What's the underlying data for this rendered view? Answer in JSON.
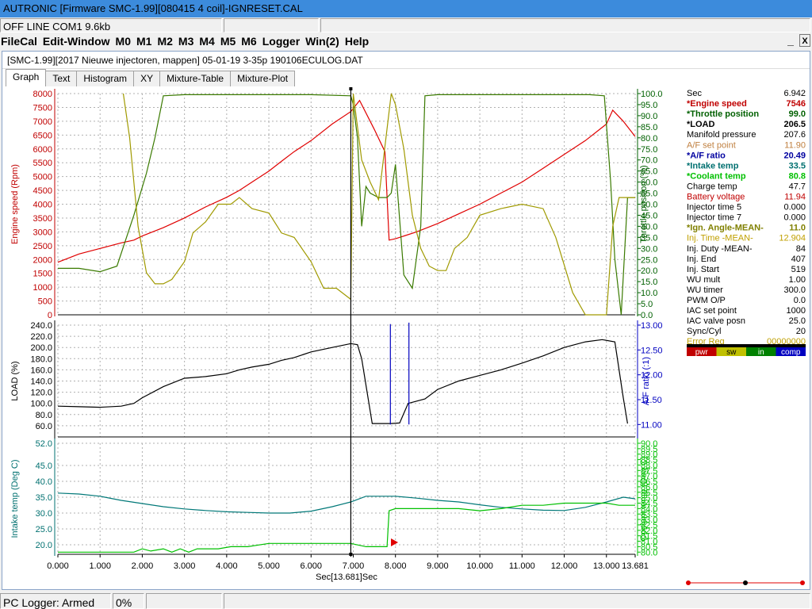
{
  "window": {
    "title": "AUTRONIC [Firmware SMC-1.99][080415 4 coil]-IGNRESET.CAL",
    "status_left": "OFF LINE COM1 9.6kb"
  },
  "menu": [
    "FileCal",
    "Edit-Window",
    "M0",
    "M1",
    "M2",
    "M3",
    "M4",
    "M5",
    "M6",
    "Logger",
    "Win(2)",
    "Help"
  ],
  "win_buttons": {
    "minimize": "_",
    "close": "X"
  },
  "doc": {
    "title": "[SMC-1.99][2017 Nieuwe injectoren, mappen] 05-01-19 3-35p 190106ECULOG.DAT",
    "tabs": [
      "Graph",
      "Text",
      "Histogram",
      "XY",
      "Mixture-Table",
      "Mixture-Plot"
    ],
    "active_tab": 0
  },
  "statusbar": {
    "logger": "PC Logger: Armed",
    "percent": "0%"
  },
  "data_panel": {
    "rows": [
      {
        "label": "Sec",
        "value": "6.942",
        "color": "#000000",
        "bold": false
      },
      {
        "label": "*Engine speed",
        "value": "7546",
        "color": "#c00000",
        "bold": true
      },
      {
        "label": "*Throttle position",
        "value": "99.0",
        "color": "#006000",
        "bold": true
      },
      {
        "label": "*LOAD",
        "value": "206.5",
        "color": "#000000",
        "bold": true
      },
      {
        "label": "Manifold pressure",
        "value": "207.6",
        "color": "#000000",
        "bold": false
      },
      {
        "label": "A/F set point",
        "value": "11.90",
        "color": "#c08040",
        "bold": false
      },
      {
        "label": "*A/F ratio",
        "value": "20.49",
        "color": "#0000a0",
        "bold": true
      },
      {
        "label": "*Intake temp",
        "value": "33.5",
        "color": "#007070",
        "bold": true
      },
      {
        "label": "*Coolant temp",
        "value": "80.8",
        "color": "#00c000",
        "bold": true
      },
      {
        "label": "Charge temp",
        "value": "47.7",
        "color": "#000000",
        "bold": false
      },
      {
        "label": "Battery voltage",
        "value": "11.94",
        "color": "#c00000",
        "bold": false
      },
      {
        "label": "Injector time 5",
        "value": "0.000",
        "color": "#000000",
        "bold": false
      },
      {
        "label": "Injector time 7",
        "value": "0.000",
        "color": "#000000",
        "bold": false
      },
      {
        "label": "*Ign. Angle-MEAN-",
        "value": "11.0",
        "color": "#808000",
        "bold": true
      },
      {
        "label": "Inj. Time -MEAN-",
        "value": "12.904",
        "color": "#c0a000",
        "bold": false
      },
      {
        "label": "Inj. Duty -MEAN-",
        "value": "84",
        "color": "#000000",
        "bold": false
      },
      {
        "label": "Inj. End",
        "value": "407",
        "color": "#000000",
        "bold": false
      },
      {
        "label": "Inj. Start",
        "value": "519",
        "color": "#000000",
        "bold": false
      },
      {
        "label": "WU mult",
        "value": "1.00",
        "color": "#000000",
        "bold": false
      },
      {
        "label": "WU timer",
        "value": "300.0",
        "color": "#000000",
        "bold": false
      },
      {
        "label": "PWM O/P",
        "value": "0.0",
        "color": "#000000",
        "bold": false
      },
      {
        "label": "IAC set point",
        "value": "1000",
        "color": "#000000",
        "bold": false
      },
      {
        "label": "IAC valve posn",
        "value": "25.0",
        "color": "#000000",
        "bold": false
      },
      {
        "label": "Sync/Cyl",
        "value": "20",
        "color": "#000000",
        "bold": false
      },
      {
        "label": "Error Reg",
        "value": "00000000",
        "color": "#c0a000",
        "bold": false
      }
    ],
    "flags": [
      {
        "label": "pwr",
        "bg": "#c00000",
        "fg": "#ffffff"
      },
      {
        "label": "sw",
        "bg": "#c0c000",
        "fg": "#000000"
      },
      {
        "label": "in",
        "bg": "#008000",
        "fg": "#ffffff"
      },
      {
        "label": "comp",
        "bg": "#0000c0",
        "fg": "#ffffff"
      }
    ]
  },
  "chart_data": {
    "type": "line",
    "x_label": "Sec[13.681]Sec",
    "x_range": [
      0,
      13.681
    ],
    "x_ticks": [
      "0.000",
      "1.000",
      "2.000",
      "3.000",
      "4.000",
      "5.000",
      "6.000",
      "7.000",
      "8.000",
      "9.000",
      "10.000",
      "11.000",
      "12.000",
      "13.000",
      "13.681"
    ],
    "cursor_x": 6.942,
    "grid": true,
    "panels": [
      {
        "left_label": "Engine speed (Rpm)",
        "right_label": "Throttle position (%)",
        "left_range": [
          0,
          8000
        ],
        "left_ticks": [
          "0",
          "500",
          "1000",
          "1500",
          "2000",
          "2500",
          "3000",
          "3500",
          "4000",
          "4500",
          "5000",
          "5500",
          "6000",
          "6500",
          "7000",
          "7500",
          "8000"
        ],
        "right_range": [
          0,
          100
        ],
        "right_ticks": [
          "0.0",
          "5.0",
          "10.0",
          "15.0",
          "20.0",
          "25.0",
          "30.0",
          "35.0",
          "40.0",
          "45.0",
          "50.0",
          "55.0",
          "60.0",
          "65.0",
          "70.0",
          "75.0",
          "80.0",
          "85.0",
          "90.0",
          "95.0",
          "100.0"
        ],
        "left_color": "#c00000",
        "right_color": "#006000",
        "series": [
          {
            "axis": "left",
            "color": "#e00000",
            "x": [
              0,
              0.5,
              1,
              1.5,
              1.8,
              2,
              2.5,
              3,
              3.5,
              4,
              4.3,
              4.6,
              5,
              5.3,
              5.6,
              6,
              6.5,
              6.942,
              7.15,
              7.5,
              7.75,
              7.85,
              8,
              8.5,
              9,
              9.5,
              10,
              10.5,
              11,
              11.5,
              12,
              12.5,
              13,
              13.15,
              13.4,
              13.681
            ],
            "y": [
              1900,
              2200,
              2400,
              2600,
              2700,
              2850,
              3150,
              3500,
              3900,
              4250,
              4500,
              4800,
              5200,
              5550,
              5900,
              6300,
              6900,
              7350,
              7750,
              6700,
              5900,
              2700,
              2750,
              3000,
              3300,
              3650,
              4000,
              4400,
              4800,
              5300,
              5800,
              6300,
              6900,
              7400,
              7000,
              6450
            ]
          },
          {
            "axis": "right",
            "color": "#3a7a00",
            "x": [
              0,
              0.5,
              1,
              1.4,
              1.8,
              2.1,
              2.3,
              2.5,
              3,
              5,
              6,
              6.942,
              7.0,
              7.1,
              7.2,
              7.3,
              7.4,
              7.6,
              7.8,
              7.9,
              8.0,
              8.2,
              8.4,
              8.6,
              8.7,
              9,
              10,
              11,
              12,
              12.6,
              12.95,
              13.1,
              13.2,
              13.35,
              13.5,
              13.681
            ],
            "y": [
              21,
              21,
              19.5,
              22,
              45,
              64,
              80,
              99,
              99.5,
              99.5,
              99.5,
              99,
              95,
              80,
              40,
              58,
              55,
              53,
              53,
              55,
              68,
              18,
              12,
              40,
              99,
              99.5,
              99.5,
              99.5,
              99.5,
              99.5,
              99,
              60,
              25,
              0,
              53,
              53
            ]
          },
          {
            "axis": "right",
            "color": "#a09a00",
            "x": [
              1.55,
              1.7,
              1.9,
              2.1,
              2.3,
              2.5,
              2.7,
              3,
              3.2,
              3.5,
              3.8,
              4.1,
              4.3,
              4.6,
              5,
              5.3,
              5.6,
              6,
              6.3,
              6.6,
              6.942,
              7.0,
              7.2,
              7.4,
              7.6,
              7.9,
              8.0,
              8.2,
              8.4,
              8.6,
              8.8,
              9,
              9.2,
              9.4,
              9.7,
              10,
              10.5,
              11,
              11.5,
              11.8,
              12.2,
              12.5,
              13,
              13.15,
              13.3,
              13.5,
              13.681
            ],
            "y": [
              100,
              80,
              40,
              19,
              14,
              14,
              16,
              24,
              37,
              42,
              50,
              50,
              53,
              48,
              46,
              37,
              35,
              24,
              12,
              12,
              7,
              100,
              70,
              60,
              52,
              100,
              95,
              75,
              45,
              30,
              22,
              20,
              20,
              30,
              35,
              45,
              48,
              50,
              48,
              35,
              10,
              0,
              0,
              40,
              53,
              53,
              53
            ]
          }
        ]
      },
      {
        "left_label": "LOAD (%)",
        "right_label": "A/F ratio (:1)",
        "left_range": [
          40,
          240
        ],
        "left_ticks": [
          "60.0",
          "80.0",
          "100.0",
          "120.0",
          "140.0",
          "160.0",
          "180.0",
          "200.0",
          "220.0",
          "240.0"
        ],
        "right_range": [
          10.75,
          13.0
        ],
        "right_ticks": [
          "11.00",
          "11.50",
          "12.00",
          "12.50",
          "13.00"
        ],
        "left_color": "#000000",
        "right_color": "#0000c0",
        "series": [
          {
            "axis": "left",
            "color": "#000000",
            "x": [
              0,
              0.5,
              1,
              1.5,
              1.8,
              2,
              2.5,
              3,
              3.5,
              4,
              4.3,
              4.6,
              5,
              5.3,
              5.6,
              6,
              6.5,
              6.942,
              7.1,
              7.2,
              7.35,
              7.45,
              7.9,
              8.1,
              8.3,
              8.7,
              9,
              9.5,
              10,
              10.5,
              11,
              11.5,
              12,
              12.5,
              12.9,
              13.2,
              13.4,
              13.5
            ],
            "y": [
              95,
              94,
              93,
              95,
              100,
              110,
              130,
              145,
              148,
              153,
              160,
              165,
              170,
              177,
              182,
              192,
              200,
              207,
              205,
              180,
              110,
              64,
              64,
              65,
              100,
              108,
              125,
              140,
              150,
              160,
              172,
              185,
              200,
              210,
              214,
              210,
              110,
              64
            ]
          },
          {
            "axis": "right",
            "color": "#0000c0",
            "x": [
              7.88,
              7.88
            ],
            "y": [
              11.0,
              13.02
            ]
          },
          {
            "axis": "right",
            "color": "#0000c0",
            "x": [
              8.32,
              8.32
            ],
            "y": [
              11.0,
              13.05
            ]
          }
        ]
      },
      {
        "left_label": "Intake temp (Deg C)",
        "right_label": "Coolant temp (Deg C)",
        "left_range": [
          17,
          52
        ],
        "left_ticks": [
          "20.0",
          "25.0",
          "30.0",
          "35.0",
          "40.0",
          "45.0",
          "52.0"
        ],
        "right_range": [
          79.8,
          90
        ],
        "right_ticks": [
          "80.0",
          "80.5",
          "81.0",
          "81.5",
          "82.0",
          "82.5",
          "83.0",
          "83.5",
          "84.0",
          "84.5",
          "85.0",
          "85.5",
          "86.0",
          "86.5",
          "87.0",
          "87.5",
          "88.0",
          "88.5",
          "89.0",
          "89.5",
          "90.0"
        ],
        "left_color": "#007070",
        "right_color": "#00c000",
        "series": [
          {
            "axis": "left",
            "color": "#007878",
            "x": [
              0,
              0.5,
              1,
              1.5,
              2,
              2.5,
              3,
              3.5,
              4,
              4.5,
              5,
              5.5,
              6,
              6.5,
              6.942,
              7.3,
              8,
              8.5,
              9,
              9.5,
              10,
              10.5,
              11,
              11.5,
              12,
              12.5,
              13,
              13.4,
              13.681
            ],
            "y": [
              36.3,
              36.0,
              35.3,
              34.0,
              33.0,
              32.0,
              31.3,
              30.8,
              30.4,
              30.2,
              30.0,
              30.0,
              30.6,
              32.0,
              33.5,
              35.3,
              35.3,
              34.7,
              34.0,
              33.5,
              32.6,
              31.8,
              31.3,
              30.9,
              30.8,
              31.8,
              33.5,
              35.0,
              34.5
            ]
          },
          {
            "axis": "right",
            "color": "#00c000",
            "x": [
              0,
              1.0,
              1.8,
              2.0,
              2.2,
              2.5,
              2.7,
              2.9,
              3.1,
              3.3,
              3.5,
              3.8,
              4.1,
              4.5,
              5.0,
              5.5,
              6.0,
              6.5,
              6.942,
              7.3,
              7.8,
              7.85,
              8.0,
              8.5,
              9.0,
              9.5,
              10.0,
              10.5,
              11.0,
              11.5,
              12.0,
              12.5,
              13.0,
              13.3,
              13.681
            ],
            "y": [
              80.0,
              80.0,
              80.0,
              80.3,
              80.1,
              80.3,
              80.0,
              80.3,
              80.0,
              80.3,
              80.3,
              80.3,
              80.5,
              80.5,
              80.8,
              80.8,
              80.8,
              80.8,
              80.8,
              80.5,
              80.5,
              83.8,
              84.0,
              84.0,
              84.0,
              84.0,
              83.8,
              84.0,
              84.3,
              84.3,
              84.5,
              84.5,
              84.5,
              84.3,
              84.3
            ]
          }
        ]
      }
    ]
  }
}
